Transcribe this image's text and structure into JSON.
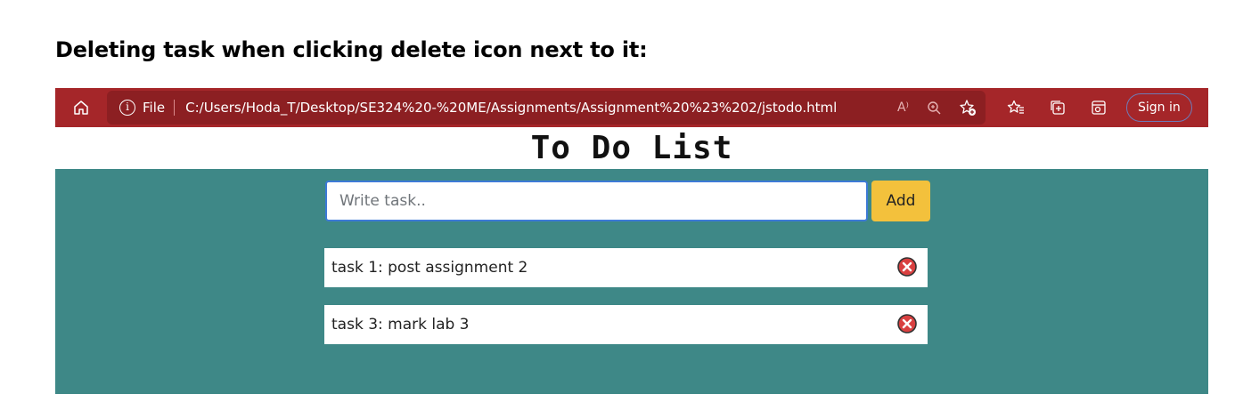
{
  "caption": "Deleting task when clicking delete icon next to it:",
  "browser": {
    "home_icon": "home-icon",
    "info_icon_glyph": "i",
    "file_label": "File",
    "url": "C:/Users/Hoda_T/Desktop/SE324%20-%20ME/Assignments/Assignment%20%23%202/jstodo.html",
    "read_aloud": "A⁾",
    "sign_in_label": "Sign in",
    "bar_color": "#a52629"
  },
  "app": {
    "title": "To Do List",
    "input_placeholder": "Write task..",
    "add_label": "Add",
    "background_color": "#3e8887",
    "tasks": [
      {
        "text": "task 1: post assignment 2"
      },
      {
        "text": "task 3: mark lab 3"
      }
    ]
  }
}
